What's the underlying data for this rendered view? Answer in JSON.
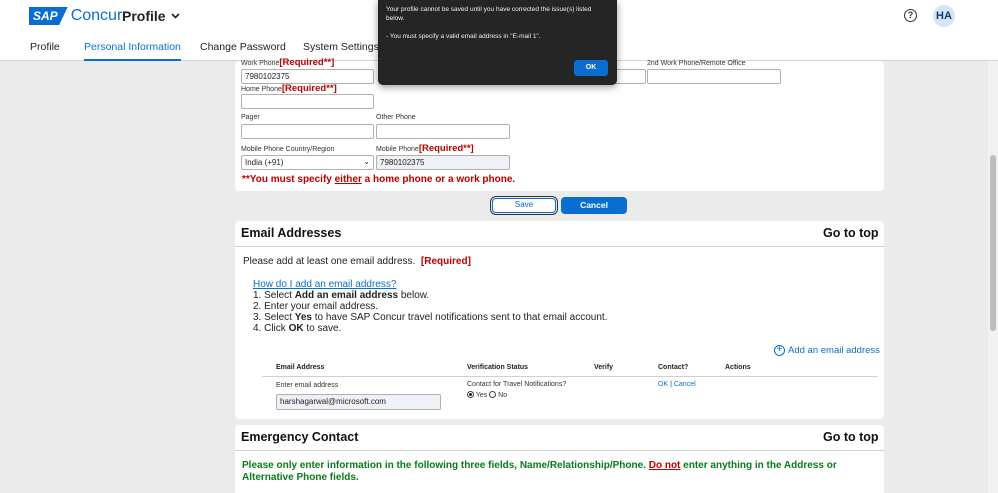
{
  "header": {
    "logo_brand": "SAP",
    "logo_product": "Concur",
    "app_title": "Profile",
    "help_symbol": "?",
    "user_initials": "HA"
  },
  "tabs": [
    "Profile",
    "Personal Information",
    "Change Password",
    "System Settings"
  ],
  "phones": {
    "work_phone_label": "Work Phone",
    "work_phone_req": "[Required**]",
    "work_phone_value": "7980102375",
    "second_work_label": "2nd Work Phone/Remote Office",
    "home_phone_label": "Home Phone",
    "home_phone_req": "[Required**]",
    "pager_label": "Pager",
    "other_phone_label": "Other Phone",
    "mobile_country_label": "Mobile Phone Country/Region",
    "mobile_country_value": "India (+91)",
    "mobile_phone_label": "Mobile Phone",
    "mobile_phone_req": "[Required**]",
    "mobile_phone_value": "7980102375",
    "warning_pre": "**You must specify ",
    "warning_either": "either",
    "warning_post": " a home phone or a work phone."
  },
  "buttons": {
    "save": "Save",
    "cancel": "Cancel"
  },
  "email": {
    "title": "Email Addresses",
    "go_to_top": "Go to top",
    "intro": "Please add at least one email address.",
    "intro_req": "[Required]",
    "howto_link": "How do I add an email address?",
    "step1_pre": "1. Select ",
    "step1_bold": "Add an email address",
    "step1_post": " below.",
    "step2": "2. Enter your email address.",
    "step3_pre": "3. Select ",
    "step3_bold": "Yes",
    "step3_post": " to have SAP Concur travel notifications sent to that email account.",
    "step4_pre": "4. Click ",
    "step4_bold": "OK",
    "step4_post": " to save.",
    "add_link": "Add an email address",
    "col_email": "Email Address",
    "col_verification": "Verification Status",
    "col_verify": "Verify",
    "col_contact": "Contact?",
    "col_actions": "Actions",
    "enter_label": "Enter email address",
    "contact_question": "Contact for Travel Notifications?",
    "yes": "Yes",
    "no": "No",
    "ok_link": "OK",
    "divider": "|",
    "cancel_link": "Cancel",
    "email_value": "harshagarwal@microsoft.com"
  },
  "emergency": {
    "title": "Emergency Contact",
    "go_to_top": "Go to top",
    "notice_pre": "Please only enter information in the following three fields, Name/Relationship/Phone. ",
    "notice_donot": "Do not",
    "notice_post": " enter anything in the Address or Alternative Phone fields."
  },
  "modal": {
    "line1": "Your profile cannot be saved until you have corrected the issue(s) listed below.",
    "line2": "- You must specify a valid email address in \"E-mail 1\".",
    "ok": "OK"
  },
  "colors": {
    "accent": "#0a6ed1",
    "required": "#b00000",
    "notice_green": "#0a7a1a",
    "modal_bg": "#252525"
  }
}
